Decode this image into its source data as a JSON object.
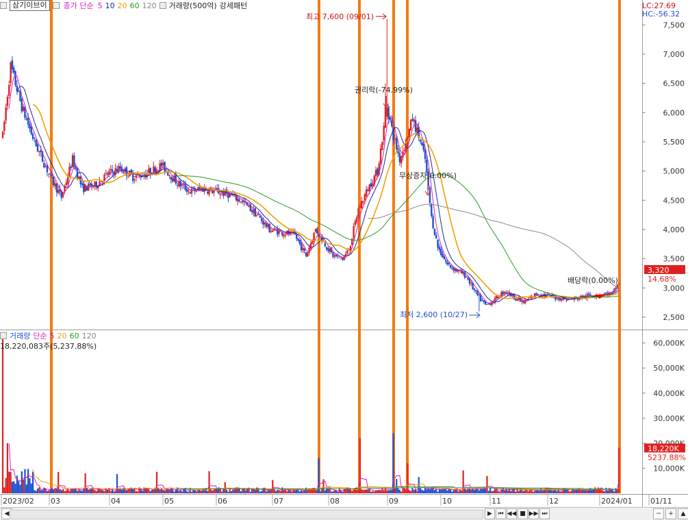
{
  "header": {
    "stock_name": "삼기이브이",
    "ma_label": "종가 단순",
    "ma_periods": [
      "5",
      "10",
      "20",
      "60",
      "120"
    ],
    "vol_label": "거래량(500억)",
    "pattern_label": "강세패턴",
    "lc": "LC:27.69",
    "hc": "HC:-56.32"
  },
  "volume_header": {
    "label": "거래량",
    "ma_label": "단순",
    "ma_periods": [
      "5",
      "20",
      "60",
      "120"
    ],
    "detail": "18,220,083주(5,237.88%)"
  },
  "colors": {
    "up": "#e0201f",
    "down": "#1f4fd0",
    "ma5": "#d020c0",
    "ma10": "#1a2a8a",
    "ma20": "#f0a000",
    "ma60": "#2a9a2a",
    "ma120": "#888888",
    "signal": "#f47a10"
  },
  "price_badge": {
    "value": "3,320",
    "pct": "14.68%"
  },
  "volume_badge": {
    "value": "18,220K",
    "pct": "5237.88%"
  },
  "annotations": {
    "high": "최고 7,600 (09/01)",
    "low": "최저 2,600 (10/27)",
    "rights": "권리락(-74.99%)",
    "bonus": "무상증자(0.00%)",
    "dividend": "배당락(0.00%)"
  },
  "chart_data": [
    {
      "type": "candlestick",
      "title": "삼기이브이",
      "x_ticks": [
        "2023/02",
        "03",
        "04",
        "05",
        "06",
        "07",
        "08",
        "09",
        "10",
        "11",
        "12",
        "2024/01",
        "01/11"
      ],
      "y_ticks": [
        "2,500",
        "3,000",
        "3,500",
        "4,000",
        "4,500",
        "5,000",
        "5,500",
        "6,000",
        "6,500",
        "7,000",
        "7,500"
      ],
      "ylim": [
        2300,
        7750
      ],
      "series": [
        {
          "name": "5",
          "values": [
            6400,
            5600,
            5200,
            4800,
            4950,
            5100,
            4750,
            4650,
            4350,
            3950,
            3900,
            3600,
            3500,
            4150,
            4500,
            5500,
            4800,
            4200,
            3200,
            2900,
            2850,
            2850,
            2900
          ]
        },
        {
          "name": "10",
          "values": [
            6500,
            5800,
            5300,
            4950,
            5000,
            5050,
            4800,
            4700,
            4450,
            4050,
            3850,
            3650,
            3450,
            3900,
            4300,
            5200,
            4950,
            4400,
            3300,
            2950,
            2870,
            2850,
            2880
          ]
        },
        {
          "name": "20",
          "values": [
            6300,
            6000,
            5600,
            5150,
            5000,
            4950,
            4870,
            4700,
            4550,
            4200,
            3950,
            3800,
            3600,
            3650,
            4000,
            4700,
            5100,
            4800,
            3600,
            3050,
            2900,
            2860,
            2870
          ]
        },
        {
          "name": "60",
          "values": [
            5100,
            5050,
            5000,
            4950,
            4900,
            4800,
            4600,
            4350,
            4200,
            4150,
            4300,
            4500,
            4600,
            4450,
            4200,
            3900,
            3550,
            3300,
            3050
          ]
        },
        {
          "name": "120",
          "values": [
            4800,
            4700,
            4600,
            4550,
            4600,
            4550,
            4400,
            4200,
            4050,
            3900,
            3750,
            3600,
            3550
          ]
        }
      ],
      "series_x": [
        "2023/02",
        "2023/02",
        "03",
        "03",
        "04",
        "04",
        "05",
        "05",
        "06",
        "06",
        "07",
        "07",
        "08",
        "08",
        "08",
        "09",
        "09",
        "10",
        "10",
        "11",
        "12",
        "2024/01",
        "2024/01"
      ],
      "high": 7600,
      "low": 2600,
      "last": 3320
    },
    {
      "type": "bar",
      "title": "거래량",
      "y_ticks": [
        "10,000K",
        "20,000K",
        "30,000K",
        "40,000K",
        "50,000K",
        "60,000K"
      ],
      "ylim": [
        0,
        64000
      ],
      "last_value": 18220083
    }
  ]
}
